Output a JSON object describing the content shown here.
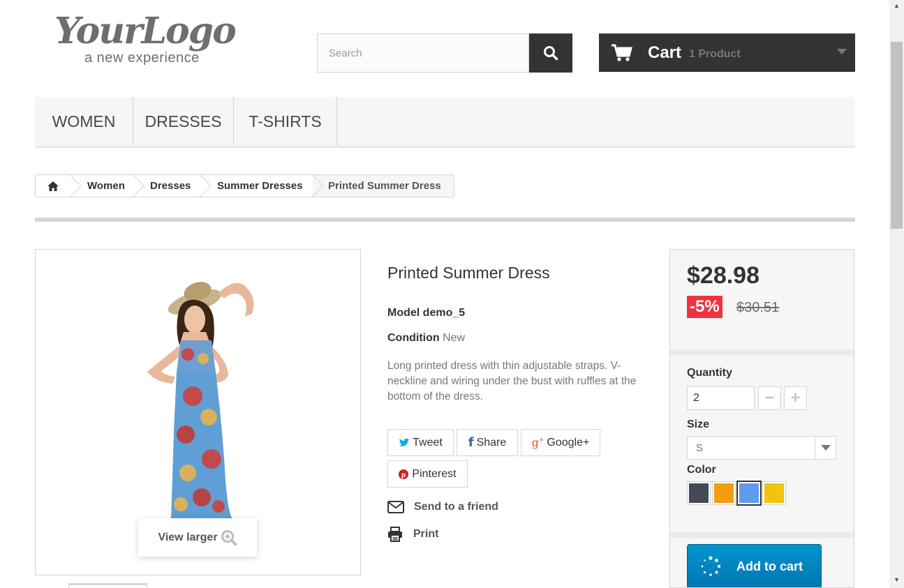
{
  "logo": {
    "main": "YourLogo",
    "tagline": "a new experience"
  },
  "search": {
    "placeholder": "Search",
    "button_icon": "search-icon"
  },
  "cart": {
    "label": "Cart",
    "count": "1 Product",
    "icon": "cart-icon"
  },
  "menu": {
    "items": [
      "WOMEN",
      "DRESSES",
      "T-SHIRTS"
    ]
  },
  "breadcrumb": {
    "home_icon": "home-icon",
    "items": [
      "Women",
      "Dresses",
      "Summer Dresses"
    ],
    "current": "Printed Summer Dress"
  },
  "image": {
    "view_larger": "View larger",
    "zoom_icon": "zoom-icon"
  },
  "product": {
    "title": "Printed Summer Dress",
    "model_label": "Model",
    "model_value": "demo_5",
    "condition_label": "Condition",
    "condition_value": "New",
    "description": "Long printed dress with thin adjustable straps. V-neckline and wiring under the bust with ruffles at the bottom of the dress."
  },
  "share": {
    "tweet": "Tweet",
    "share": "Share",
    "google": "Google+",
    "pinterest": "Pinterest"
  },
  "links": {
    "send_friend": "Send to a friend",
    "print": "Print"
  },
  "buy": {
    "price": "$28.98",
    "discount": "-5%",
    "old_price": "$30.51",
    "quantity_label": "Quantity",
    "quantity_value": "2",
    "size_label": "Size",
    "size_value": "S",
    "color_label": "Color",
    "colors": [
      "#434a54",
      "#f39c11",
      "#5d9cec",
      "#f1c40f"
    ],
    "selected_color_index": 2,
    "add_to_cart": "Add to cart"
  }
}
